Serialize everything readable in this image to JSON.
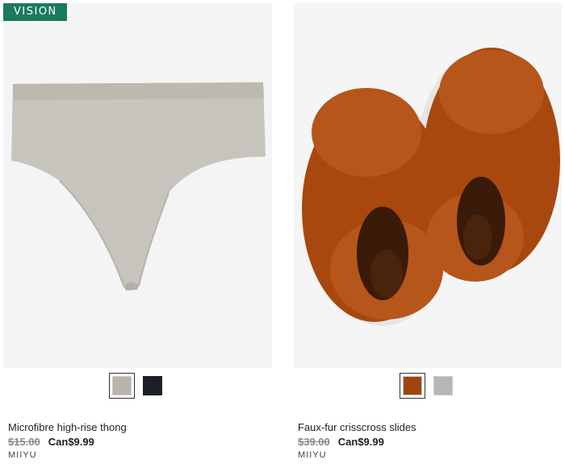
{
  "badge": {
    "label": "VISION",
    "color": "#1a7a5e"
  },
  "products": [
    {
      "title": "Microfibre high-rise thong",
      "was_price": "$15.00",
      "now_price": "Can$9.99",
      "brand": "MIIYU",
      "swatches": [
        {
          "name": "taupe",
          "color": "#b9b4ab",
          "selected": true
        },
        {
          "name": "black",
          "color": "#1d1f26",
          "selected": false
        }
      ]
    },
    {
      "title": "Faux-fur crisscross slides",
      "was_price": "$39.00",
      "now_price": "Can$9.99",
      "brand": "MIIYU",
      "swatches": [
        {
          "name": "rust",
          "color": "#a0440f",
          "selected": true
        },
        {
          "name": "grey",
          "color": "#b5b6b9",
          "selected": false
        }
      ]
    }
  ]
}
